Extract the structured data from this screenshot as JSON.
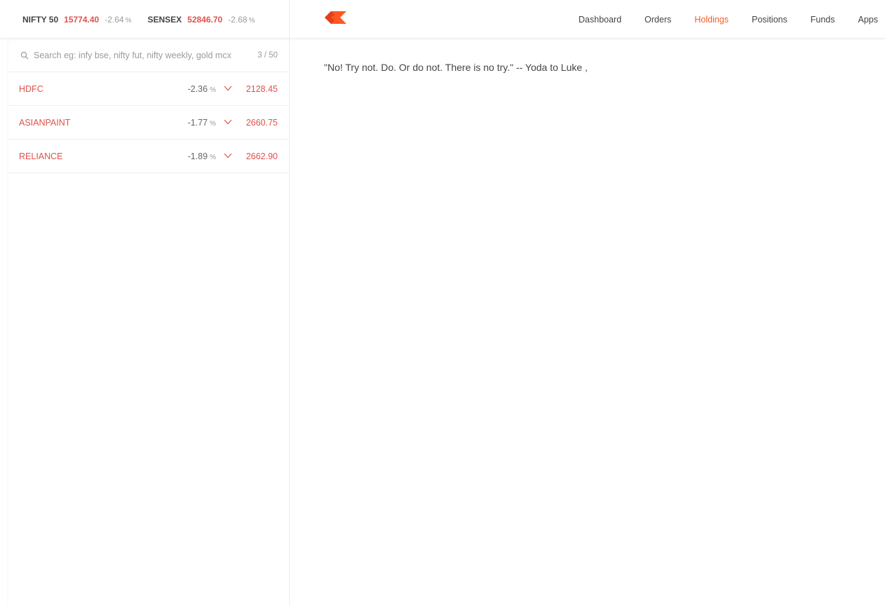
{
  "indices": [
    {
      "name": "NIFTY 50",
      "value": "15774.40",
      "change": "-2.64",
      "pct": "%"
    },
    {
      "name": "SENSEX",
      "value": "52846.70",
      "change": "-2.68",
      "pct": "%"
    }
  ],
  "logo": {
    "icon": "kite-logo-icon",
    "color": "#ff5722"
  },
  "nav": {
    "items": [
      "Dashboard",
      "Orders",
      "Holdings",
      "Positions",
      "Funds",
      "Apps"
    ],
    "active": "Holdings"
  },
  "search": {
    "placeholder": "Search eg: infy bse, nifty fut, nifty weekly, gold mcx",
    "value": "",
    "count": "3 / 50",
    "icon": "search-icon"
  },
  "watchlist": {
    "rows": [
      {
        "symbol": "HDFC",
        "change": "-2.36",
        "pct": "%",
        "price": "2128.45"
      },
      {
        "symbol": "ASIANPAINT",
        "change": "-1.77",
        "pct": "%",
        "price": "2660.75"
      },
      {
        "symbol": "RELIANCE",
        "change": "-1.89",
        "pct": "%",
        "price": "2662.90"
      }
    ]
  },
  "main": {
    "quote": "\"No! Try not. Do. Or do not. There is no try.\" -- Yoda to Luke ,"
  },
  "colors": {
    "accent": "#ff5722",
    "loss": "#df514c",
    "text": "#444444",
    "muted": "#9b9b9b"
  }
}
